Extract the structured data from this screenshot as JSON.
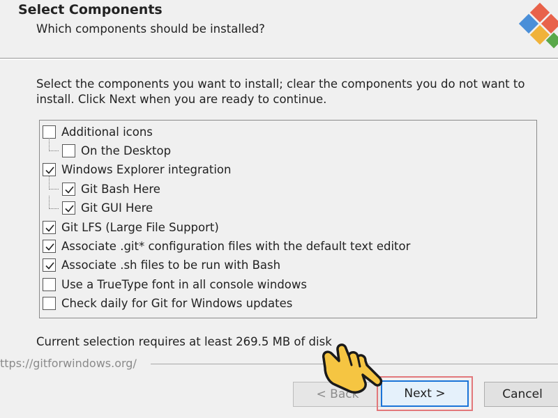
{
  "header": {
    "title": "Select Components",
    "subtitle": "Which components should be installed?"
  },
  "instructions": "Select the components you want to install; clear the components you do not want to install. Click Next when you are ready to continue.",
  "components": [
    {
      "label": "Additional icons",
      "checked": false,
      "level": 0
    },
    {
      "label": "On the Desktop",
      "checked": false,
      "level": 1
    },
    {
      "label": "Windows Explorer integration",
      "checked": true,
      "level": 0
    },
    {
      "label": "Git Bash Here",
      "checked": true,
      "level": 1
    },
    {
      "label": "Git GUI Here",
      "checked": true,
      "level": 1
    },
    {
      "label": "Git LFS (Large File Support)",
      "checked": true,
      "level": 0
    },
    {
      "label": "Associate .git* configuration files with the default text editor",
      "checked": true,
      "level": 0
    },
    {
      "label": "Associate .sh files to be run with Bash",
      "checked": true,
      "level": 0
    },
    {
      "label": "Use a TrueType font in all console windows",
      "checked": false,
      "level": 0
    },
    {
      "label": "Check daily for Git for Windows updates",
      "checked": false,
      "level": 0
    }
  ],
  "status": "Current selection requires at least 269.5 MB of disk",
  "footer_url": "ttps://gitforwindows.org/",
  "buttons": {
    "back": "< Back",
    "next": "Next >",
    "cancel": "Cancel"
  },
  "colors": {
    "accent_focus": "#1a74d8",
    "highlight_box": "#e2777a",
    "hand": "#f5c542"
  },
  "icons": {
    "logo": "git-logo-icon",
    "pointer": "pointing-hand-icon"
  }
}
